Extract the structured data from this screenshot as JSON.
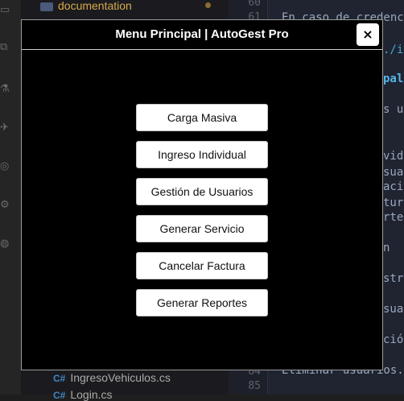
{
  "explorer": {
    "folder_label": "documentation",
    "file1": "IngresoVehiculos.cs",
    "file1_badge": "C#",
    "file2": "Login.cs",
    "file2_badge": "C#"
  },
  "editor": {
    "line_numbers": [
      "60",
      "61",
      "84",
      "85"
    ],
    "code_lines": [
      "En caso de credenc",
      "./i",
      "pal",
      "s us",
      "vidu",
      "suar",
      "acio",
      "tura",
      "rtes",
      "n",
      "stra",
      "suar",
      "ción",
      "Eliminar usuarios."
    ]
  },
  "dialog": {
    "title": "Menu Principal | AutoGest Pro",
    "close_label": "×",
    "buttons": [
      {
        "label": "Carga Masiva"
      },
      {
        "label": "Ingreso Individual"
      },
      {
        "label": "Gestión de Usuarios"
      },
      {
        "label": "Generar Servicio"
      },
      {
        "label": "Cancelar Factura"
      },
      {
        "label": "Generar Reportes"
      }
    ]
  },
  "colors": {
    "dialog_bg": "#000000",
    "button_bg": "#ffffff",
    "title_text": "#ffffff"
  }
}
